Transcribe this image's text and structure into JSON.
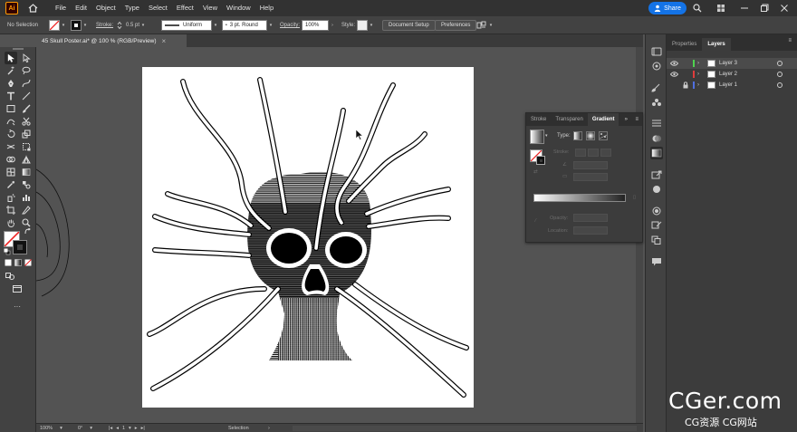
{
  "menu": {
    "app_logo": "Ai",
    "items": [
      "File",
      "Edit",
      "Object",
      "Type",
      "Select",
      "Effect",
      "View",
      "Window",
      "Help"
    ],
    "share_label": "Share"
  },
  "control": {
    "selection_state": "No Selection",
    "stroke_label": "Stroke:",
    "stroke_value": "0.5 pt",
    "profile_value": "Uniform",
    "brush_value": "3 pt. Round",
    "opacity_label": "Opacity:",
    "opacity_value": "100%",
    "style_label": "Style:",
    "doc_setup_label": "Document Setup",
    "preferences_label": "Preferences"
  },
  "document": {
    "tab_title": "45 Skull Poster.ai* @ 100 % (RGB/Preview)",
    "close_glyph": "×"
  },
  "gradient_panel": {
    "tabs": [
      "Stroke",
      "Transparen",
      "Gradient"
    ],
    "active_tab": "Gradient",
    "type_label": "Type:",
    "stroke_label": "Stroke:",
    "opacity_label": "Opacity:",
    "location_label": "Location:"
  },
  "layers_panel": {
    "tabs": [
      "Properties",
      "Layers"
    ],
    "active_tab": "Layers",
    "layers": [
      {
        "name": "Layer 3",
        "color": "#4fd34f",
        "visible": true,
        "locked": false,
        "selected": true
      },
      {
        "name": "Layer 2",
        "color": "#e03c3c",
        "visible": true,
        "locked": false,
        "selected": false
      },
      {
        "name": "Layer 1",
        "color": "#4f6fe0",
        "visible": false,
        "locked": true,
        "selected": false
      }
    ]
  },
  "status": {
    "zoom": "100%",
    "rotation": "0°",
    "artboard_index": "1",
    "tool_name": "Selection"
  },
  "watermark": {
    "line1": "CGer.com",
    "line2": "CG资源 CG网站"
  },
  "colors": {
    "accent_blue": "#1473e6",
    "panel_bg": "#3c3c3c",
    "canvas_bg": "#535353",
    "ai_orange": "#ff9a00"
  }
}
